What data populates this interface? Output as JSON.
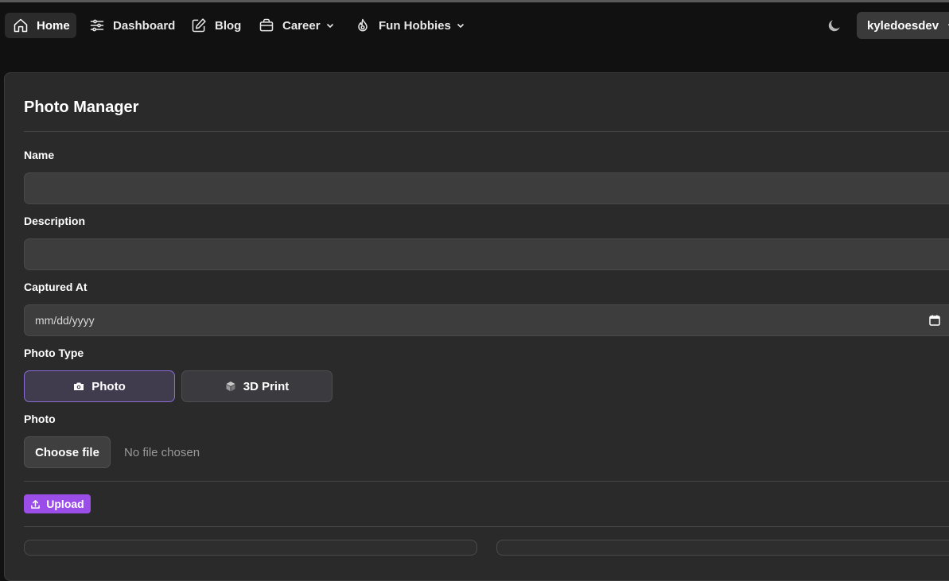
{
  "nav": {
    "items": [
      {
        "label": "Home",
        "icon": "home-icon",
        "active": true
      },
      {
        "label": "Dashboard",
        "icon": "sliders-icon"
      },
      {
        "label": "Blog",
        "icon": "pencil-icon"
      },
      {
        "label": "Career",
        "icon": "briefcase-icon",
        "dropdown": true
      },
      {
        "label": "Fun Hobbies",
        "icon": "flame-icon",
        "dropdown": true
      }
    ],
    "theme_icon": "moon-icon",
    "user": "kyledoesdev"
  },
  "form": {
    "title": "Photo Manager",
    "name_label": "Name",
    "name_value": "",
    "description_label": "Description",
    "description_value": "",
    "captured_label": "Captured At",
    "captured_placeholder": "mm/dd/yyyy",
    "type_label": "Photo Type",
    "type_options": [
      {
        "label": "Photo",
        "icon": "camera-icon",
        "selected": true
      },
      {
        "label": "3D Print",
        "icon": "cube-icon",
        "selected": false
      }
    ],
    "photo_label": "Photo",
    "choose_file": "Choose file",
    "no_file": "No file chosen",
    "upload": "Upload"
  },
  "colors": {
    "accent": "#9b4de8",
    "selected_border": "#8b6bd6",
    "background": "#111111",
    "card": "#2a2a2a"
  }
}
